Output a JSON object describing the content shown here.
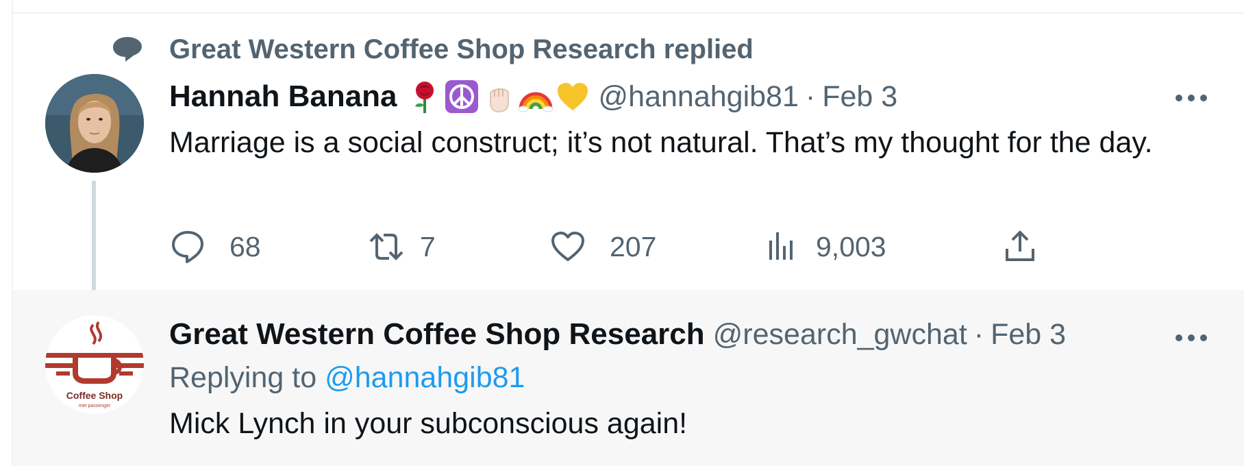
{
  "reply_context": {
    "text": "Great Western Coffee Shop Research replied",
    "icon": "speech-bubble-icon"
  },
  "tweet": {
    "author_name": "Hannah Banana",
    "author_emojis": [
      "rose",
      "peace-symbol",
      "raised-fist",
      "rainbow",
      "yellow-heart"
    ],
    "handle": "@hannahgib81",
    "separator": "·",
    "date": "Feb 3",
    "text": "Marriage is a social construct; it’s not natural. That’s my thought for the day.",
    "actions": {
      "replies": "68",
      "retweets": "7",
      "likes": "207",
      "views": "9,003"
    }
  },
  "reply": {
    "author_name": "Great Western Coffee Shop Research",
    "handle": "@research_gwchat",
    "separator": "·",
    "date": "Feb 3",
    "replying_prefix": "Replying to",
    "replying_to": "@hannahgib81",
    "text": "Mick Lynch in your subconscious again!",
    "avatar_text": "Coffee Shop",
    "avatar_subtext": "met passenger"
  },
  "colors": {
    "text_primary": "#0f1419",
    "text_secondary": "#536471",
    "link": "#1d9bf0",
    "thread_line": "#cfd9de",
    "reply_background": "#f7f7f7",
    "logo_red": "#c0392b"
  }
}
